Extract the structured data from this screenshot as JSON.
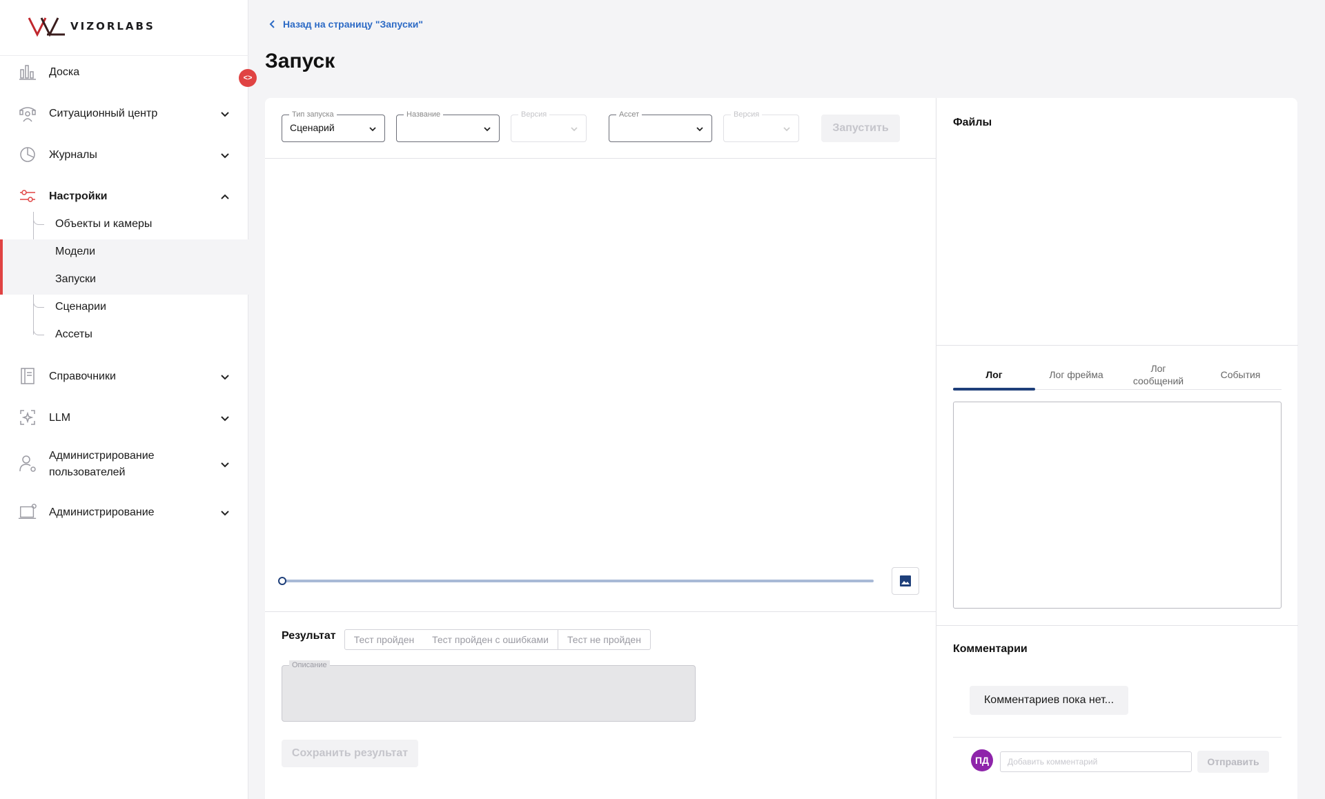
{
  "app": {
    "brand": "VIZORLABS"
  },
  "sidebar": {
    "items": [
      {
        "label": "Доска",
        "icon": "chart-bars-icon"
      },
      {
        "label": "Ситуационный центр",
        "icon": "situation-center-icon"
      },
      {
        "label": "Журналы",
        "icon": "pie-chart-icon"
      },
      {
        "label": "Настройки",
        "icon": "sliders-icon"
      },
      {
        "label": "Справочники",
        "icon": "book-icon"
      },
      {
        "label": "LLM",
        "icon": "ai-sparkle-icon"
      },
      {
        "label_line1": "Администрирование",
        "label_line2": "пользователей",
        "icon": "user-settings-icon"
      },
      {
        "label": "Администрирование",
        "icon": "admin-laptop-icon"
      }
    ],
    "subitems": [
      "Объекты и камеры",
      "Модели",
      "Запуски",
      "Сценарии",
      "Ассеты"
    ],
    "active_subitem": "Запуски"
  },
  "header": {
    "back_link": "Назад на страницу \"Запуски\"",
    "title": "Запуск"
  },
  "toolbar": {
    "launch_type": {
      "label": "Тип запуска",
      "value": "Сценарий"
    },
    "name": {
      "label": "Название",
      "value": ""
    },
    "version1": {
      "label": "Версия",
      "value": ""
    },
    "asset": {
      "label": "Ассет",
      "value": ""
    },
    "version2": {
      "label": "Версия",
      "value": ""
    },
    "run_button": "Запустить"
  },
  "player": {
    "progress": 0
  },
  "result": {
    "label": "Результат",
    "options": [
      "Тест пройден",
      "Тест пройден с ошибками",
      "Тест не пройден"
    ],
    "description_label": "Описание",
    "save_button": "Сохранить результат"
  },
  "files": {
    "title": "Файлы"
  },
  "log_tabs": {
    "tabs": [
      "Лог",
      "Лог фрейма",
      "Лог сообщений",
      "События"
    ],
    "tab3_line1": "Лог",
    "tab3_line2": "сообщений",
    "active": "Лог"
  },
  "comments": {
    "title": "Комментарии",
    "empty_text": "Комментариев пока нет...",
    "avatar_initials": "ПД",
    "input_placeholder": "Добавить комментарий",
    "send_button": "Отправить"
  },
  "colors": {
    "accent": "#e04343",
    "primary": "#1e3f7a",
    "link": "#2c6ac5",
    "avatar": "#8e24aa"
  }
}
